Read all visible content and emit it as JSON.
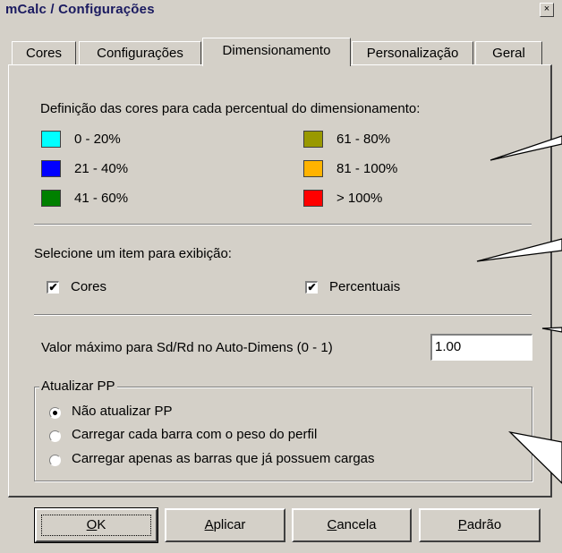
{
  "window": {
    "title": "mCalc / Configurações",
    "close_glyph": "×"
  },
  "tabs": [
    {
      "label": "Cores"
    },
    {
      "label": "Configurações"
    },
    {
      "label": "Dimensionamento"
    },
    {
      "label": "Personalização"
    },
    {
      "label": "Geral"
    }
  ],
  "active_tab": "Dimensionamento",
  "colors_section": {
    "heading": "Definição das cores para cada percentual do dimensionamento:",
    "items": [
      {
        "range": "0 - 20%",
        "color": "#00ffff"
      },
      {
        "range": "21 - 40%",
        "color": "#0000ff"
      },
      {
        "range": "41 - 60%",
        "color": "#008000"
      },
      {
        "range": "61 - 80%",
        "color": "#999900"
      },
      {
        "range": "81 - 100%",
        "color": "#ffb300"
      },
      {
        "range": "> 100%",
        "color": "#ff0000"
      }
    ]
  },
  "display_section": {
    "heading": "Selecione um item para exibição:",
    "checkboxes": [
      {
        "label": "Cores",
        "checked": true,
        "mark": "✔"
      },
      {
        "label": "Percentuais",
        "checked": true,
        "mark": "✔"
      }
    ]
  },
  "max_value": {
    "label": "Valor máximo para Sd/Rd no Auto-Dimens (0 - 1)",
    "value": "1.00"
  },
  "update_pp": {
    "legend": "Atualizar PP",
    "options": [
      {
        "label": "Não atualizar  PP",
        "selected": true
      },
      {
        "label": "Carregar cada barra com o peso do perfil",
        "selected": false
      },
      {
        "label": "Carregar apenas as barras que já possuem cargas",
        "selected": false
      }
    ]
  },
  "buttons": [
    {
      "label": "OK",
      "mnemonic": "O",
      "rest": "K"
    },
    {
      "label": "Aplicar",
      "mnemonic": "A",
      "rest": "plicar"
    },
    {
      "label": "Cancela",
      "mnemonic": "C",
      "rest": "ancela"
    },
    {
      "label": "Padrão",
      "mnemonic": "P",
      "rest": "adrão"
    }
  ]
}
